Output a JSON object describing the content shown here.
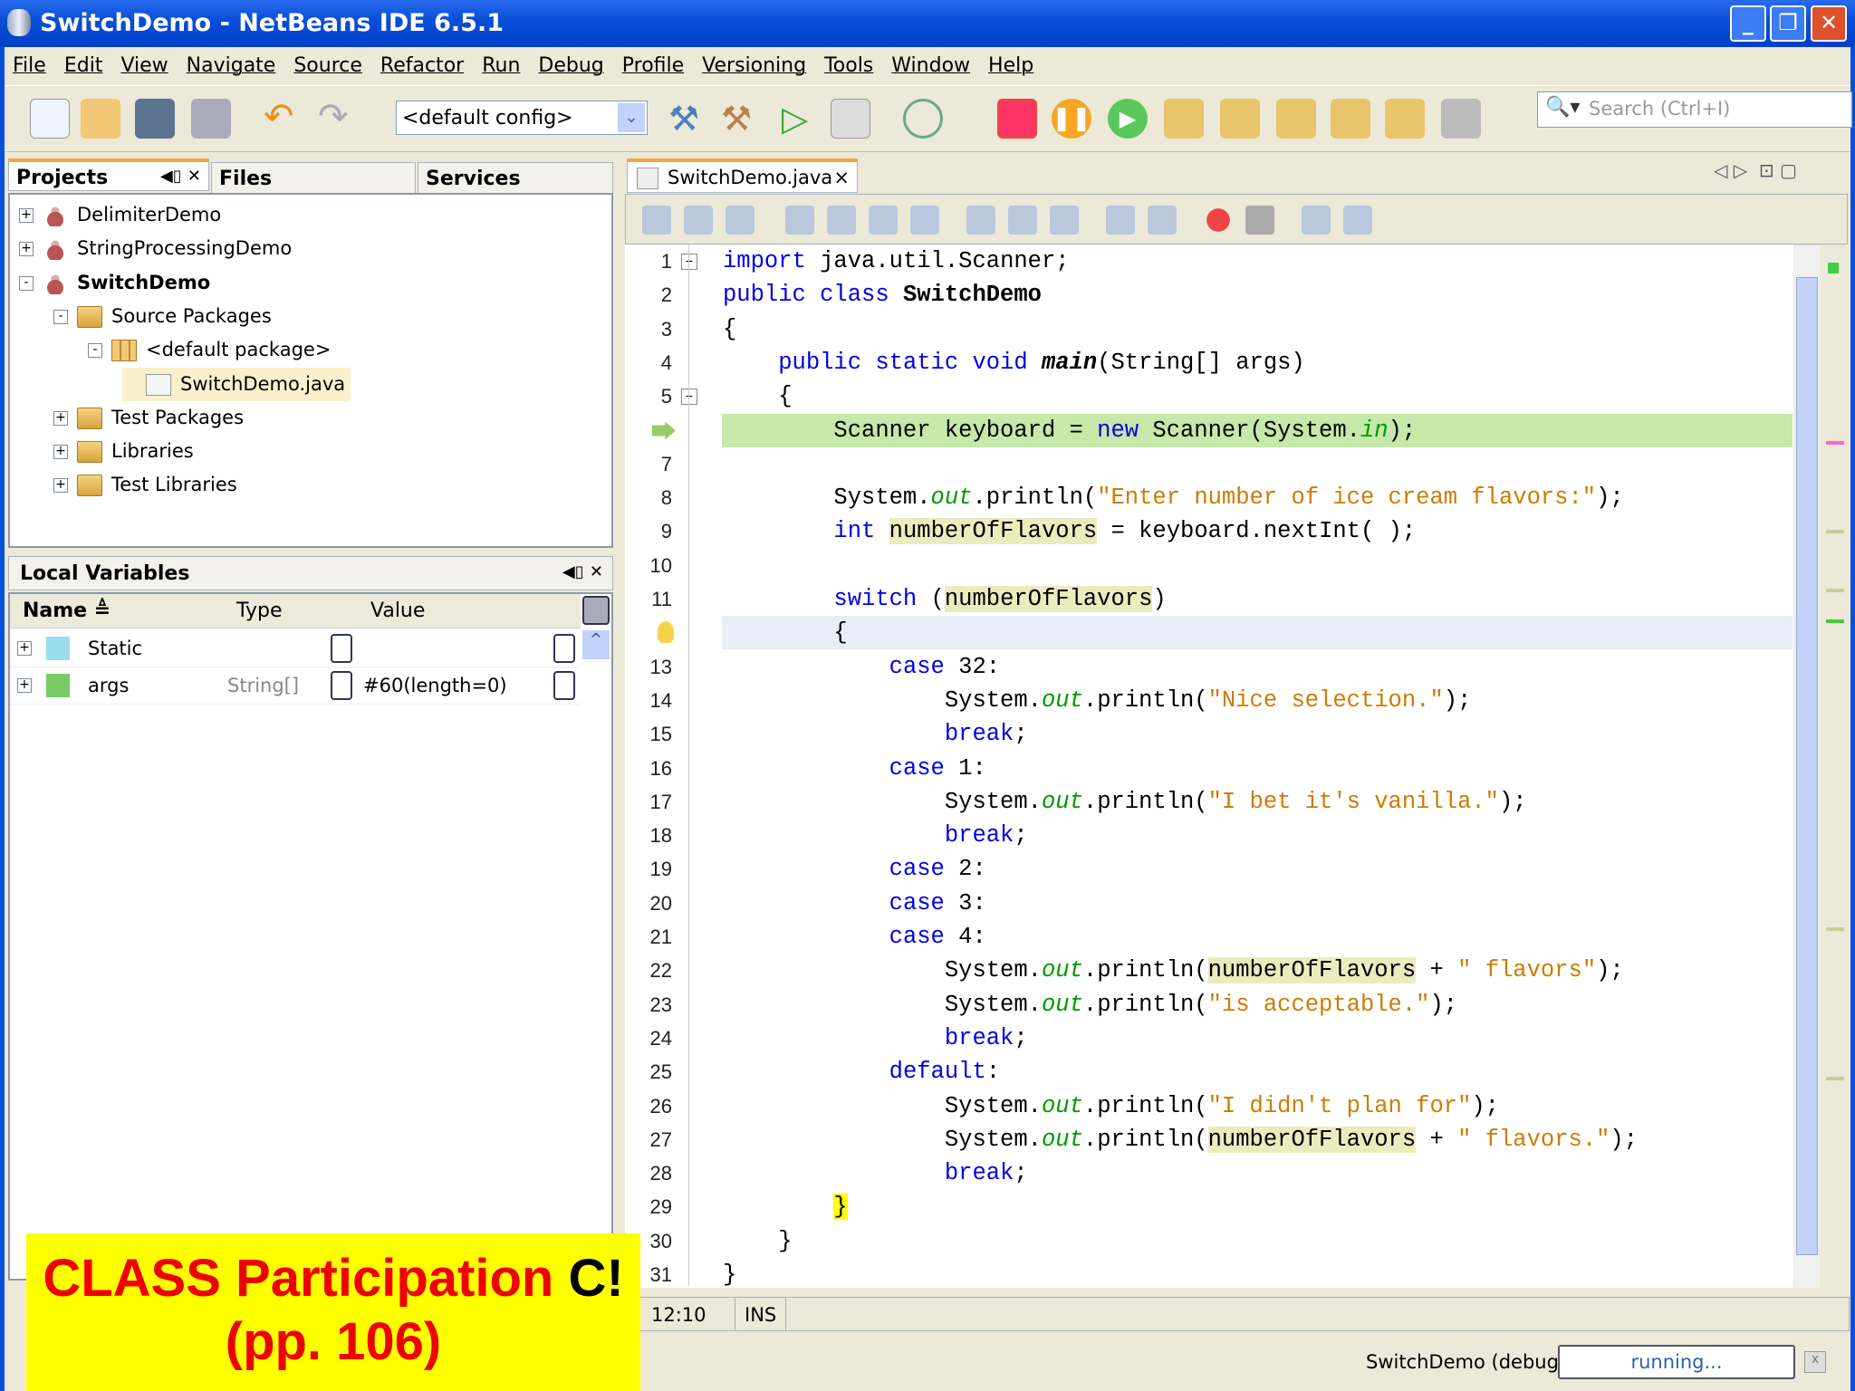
{
  "window": {
    "title": "SwitchDemo - NetBeans IDE 6.5.1"
  },
  "menu": [
    "File",
    "Edit",
    "View",
    "Navigate",
    "Source",
    "Refactor",
    "Run",
    "Debug",
    "Profile",
    "Versioning",
    "Tools",
    "Window",
    "Help"
  ],
  "toolbar": {
    "config": "<default config>",
    "search_placeholder": "Search (Ctrl+I)"
  },
  "left_tabs": [
    "Projects",
    "Files",
    "Services"
  ],
  "projects": [
    {
      "label": "DelimiterDemo",
      "depth": 0,
      "exp": "+",
      "icon": "cup"
    },
    {
      "label": "StringProcessingDemo",
      "depth": 0,
      "exp": "+",
      "icon": "cup"
    },
    {
      "label": "SwitchDemo",
      "depth": 0,
      "exp": "-",
      "icon": "cup",
      "bold": true
    },
    {
      "label": "Source Packages",
      "depth": 1,
      "exp": "-",
      "icon": "folder"
    },
    {
      "label": "<default package>",
      "depth": 2,
      "exp": "-",
      "icon": "pkg"
    },
    {
      "label": "SwitchDemo.java",
      "depth": 3,
      "exp": "",
      "icon": "jfile",
      "selected": true
    },
    {
      "label": "Test Packages",
      "depth": 1,
      "exp": "+",
      "icon": "folder"
    },
    {
      "label": "Libraries",
      "depth": 1,
      "exp": "+",
      "icon": "folder"
    },
    {
      "label": "Test Libraries",
      "depth": 1,
      "exp": "+",
      "icon": "folder"
    }
  ],
  "locals": {
    "title": "Local Variables",
    "columns": [
      "Name",
      "Type",
      "Value"
    ],
    "rows": [
      {
        "name": "Static",
        "type": "",
        "value": ""
      },
      {
        "name": "args",
        "type": "String[]",
        "value": "#60(length=0)"
      }
    ]
  },
  "editor": {
    "tab": "SwitchDemo.java",
    "position": "12:10",
    "mode": "INS"
  },
  "code": [
    [
      [
        "import",
        "kw"
      ],
      [
        " java.util.Scanner;",
        ""
      ]
    ],
    [
      [
        "public class ",
        "kw"
      ],
      [
        "SwitchDemo",
        "bold"
      ]
    ],
    [
      [
        "{",
        ""
      ]
    ],
    [
      [
        "    ",
        ""
      ],
      [
        "public static void ",
        "kw"
      ],
      [
        "main",
        "bi"
      ],
      [
        "(String[] args)",
        ""
      ]
    ],
    [
      [
        "    {",
        ""
      ]
    ],
    [
      [
        "        Scanner keyboard = ",
        ""
      ],
      [
        "new",
        "kw"
      ],
      [
        " Scanner(System.",
        ""
      ],
      [
        "in",
        "fld"
      ],
      [
        ");",
        ""
      ]
    ],
    [],
    [
      [
        "        System.",
        ""
      ],
      [
        "out",
        "fld"
      ],
      [
        ".println(",
        ""
      ],
      [
        "\"Enter number of ice cream flavors:\"",
        "str"
      ],
      [
        ");",
        ""
      ]
    ],
    [
      [
        "        ",
        ""
      ],
      [
        "int",
        "kw"
      ],
      [
        " ",
        ""
      ],
      [
        "numberOfFlavors",
        "mark"
      ],
      [
        " = keyboard.nextInt( );",
        ""
      ]
    ],
    [],
    [
      [
        "        ",
        ""
      ],
      [
        "switch",
        "kw"
      ],
      [
        " (",
        ""
      ],
      [
        "numberOfFlavors",
        "mark"
      ],
      [
        ")",
        ""
      ]
    ],
    [
      [
        "        ",
        ""
      ],
      [
        "{",
        ""
      ]
    ],
    [
      [
        "            ",
        ""
      ],
      [
        "case",
        "kw"
      ],
      [
        " 32:",
        ""
      ]
    ],
    [
      [
        "                System.",
        ""
      ],
      [
        "out",
        "fld"
      ],
      [
        ".println(",
        ""
      ],
      [
        "\"Nice selection.\"",
        "str"
      ],
      [
        ");",
        ""
      ]
    ],
    [
      [
        "                ",
        ""
      ],
      [
        "break",
        "kw"
      ],
      [
        ";",
        ""
      ]
    ],
    [
      [
        "            ",
        ""
      ],
      [
        "case",
        "kw"
      ],
      [
        " 1:",
        ""
      ]
    ],
    [
      [
        "                System.",
        ""
      ],
      [
        "out",
        "fld"
      ],
      [
        ".println(",
        ""
      ],
      [
        "\"I bet it's vanilla.\"",
        "str"
      ],
      [
        ");",
        ""
      ]
    ],
    [
      [
        "                ",
        ""
      ],
      [
        "break",
        "kw"
      ],
      [
        ";",
        ""
      ]
    ],
    [
      [
        "            ",
        ""
      ],
      [
        "case",
        "kw"
      ],
      [
        " 2:",
        ""
      ]
    ],
    [
      [
        "            ",
        ""
      ],
      [
        "case",
        "kw"
      ],
      [
        " 3:",
        ""
      ]
    ],
    [
      [
        "            ",
        ""
      ],
      [
        "case",
        "kw"
      ],
      [
        " 4:",
        ""
      ]
    ],
    [
      [
        "                System.",
        ""
      ],
      [
        "out",
        "fld"
      ],
      [
        ".println(",
        ""
      ],
      [
        "numberOfFlavors",
        "mark"
      ],
      [
        " + ",
        ""
      ],
      [
        "\" flavors\"",
        "str"
      ],
      [
        ");",
        ""
      ]
    ],
    [
      [
        "                System.",
        ""
      ],
      [
        "out",
        "fld"
      ],
      [
        ".println(",
        ""
      ],
      [
        "\"is acceptable.\"",
        "str"
      ],
      [
        ");",
        ""
      ]
    ],
    [
      [
        "                ",
        ""
      ],
      [
        "break",
        "kw"
      ],
      [
        ";",
        ""
      ]
    ],
    [
      [
        "            ",
        ""
      ],
      [
        "default",
        "kw"
      ],
      [
        ":",
        ""
      ]
    ],
    [
      [
        "                System.",
        ""
      ],
      [
        "out",
        "fld"
      ],
      [
        ".println(",
        ""
      ],
      [
        "\"I didn't plan for\"",
        "str"
      ],
      [
        ");",
        ""
      ]
    ],
    [
      [
        "                System.",
        ""
      ],
      [
        "out",
        "fld"
      ],
      [
        ".println(",
        ""
      ],
      [
        "numberOfFlavors",
        "mark"
      ],
      [
        " + ",
        ""
      ],
      [
        "\" flavors.\"",
        "str"
      ],
      [
        ");",
        ""
      ]
    ],
    [
      [
        "                ",
        ""
      ],
      [
        "break",
        "kw"
      ],
      [
        ";",
        ""
      ]
    ],
    [
      [
        "        ",
        ""
      ],
      [
        "}",
        "brace"
      ]
    ],
    [
      [
        "    }",
        ""
      ]
    ],
    [
      [
        "}",
        ""
      ]
    ]
  ],
  "status": {
    "process": "SwitchDemo (debug)",
    "progress": "running..."
  },
  "overlay": {
    "line1a": "CLASS Participation ",
    "line1b": "C!",
    "line2": "(pp. 106)"
  },
  "colors": {
    "current_line": "#c6e8a8",
    "caret_line": "#e8eef8",
    "accent": "#f4a73e"
  }
}
